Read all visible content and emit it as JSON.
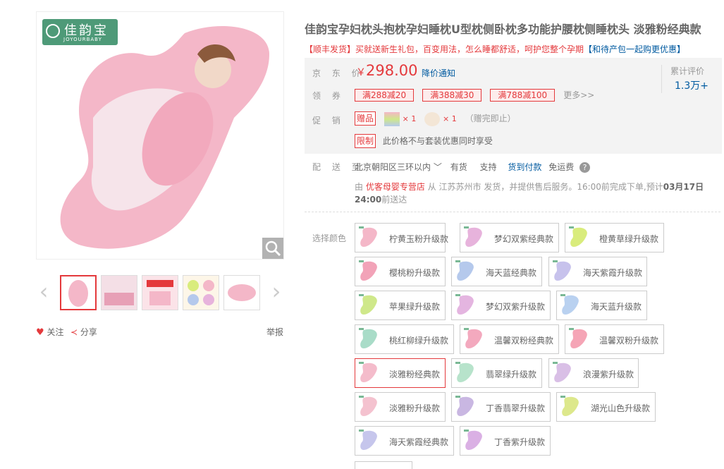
{
  "brand": {
    "name": "佳韵宝",
    "sub": "JOYOURBABY"
  },
  "product": {
    "title": "佳韵宝孕妇枕头抱枕孕妇睡枕U型枕侧卧枕多功能护腰枕侧睡枕头 淡雅粉经典款",
    "promo_text": "【顺丰发货】买就送新生礼包，百变用法，怎么睡都舒适，呵护您整个孕期",
    "promo_link": "【和待产包一起购更优惠】"
  },
  "price": {
    "label": "京 东 价",
    "symbol": "￥",
    "value": "298.00",
    "notify": "降价通知"
  },
  "review": {
    "label": "累计评价",
    "count": "1.3万+"
  },
  "coupons": {
    "label": "领 券",
    "items": [
      "满288减20",
      "满388减30",
      "满788减100"
    ],
    "more": "更多>>"
  },
  "promotion": {
    "label": "促 销",
    "gift_tag": "赠品",
    "gift_qty1": "× 1",
    "gift_qty2": "× 1",
    "gift_note": "（赠完即止）",
    "limit_tag": "限制",
    "limit_text": "此价格不与套装优惠同时享受"
  },
  "delivery": {
    "label": "配 送 至",
    "address": "北京朝阳区三环以内",
    "stock": "有货",
    "support": "支持",
    "cod": "货到付款",
    "free": "免运费",
    "by": "由",
    "store": "优客母婴专营店",
    "from": "从 江苏苏州市 发货，并提供售后服务。16:00前完成下单,预计",
    "date": "03月17日 24:00",
    "arrive": "前送达"
  },
  "actions": {
    "follow": "关注",
    "share": "分享",
    "report": "举报"
  },
  "colors": {
    "label": "选择颜色",
    "options": [
      {
        "name": "柠黄玉粉升级款",
        "tint": "#f4b7c8"
      },
      {
        "name": "梦幻双紫经典款",
        "tint": "#e7b3dc"
      },
      {
        "name": "橙黄草绿升级款",
        "tint": "#d9ec7c"
      },
      {
        "name": "樱桃粉升级款",
        "tint": "#f2a3b8"
      },
      {
        "name": "海天蓝经典款",
        "tint": "#b5c9ec"
      },
      {
        "name": "海天紫霞升级款",
        "tint": "#c7c2ec"
      },
      {
        "name": "苹果绿升级款",
        "tint": "#cfe88a"
      },
      {
        "name": "梦幻双紫升级款",
        "tint": "#e4b5e0"
      },
      {
        "name": "海天蓝升级款",
        "tint": "#b9d1f0"
      },
      {
        "name": "桃红柳绿升级款",
        "tint": "#a9dcc8"
      },
      {
        "name": "温馨双粉经典款",
        "tint": "#f3a9be"
      },
      {
        "name": "温馨双粉升级款",
        "tint": "#f5a5b6"
      },
      {
        "name": "淡雅粉经典款",
        "tint": "#f4bccb"
      },
      {
        "name": "翡翠绿升级款",
        "tint": "#b7e3cb"
      },
      {
        "name": "浪漫紫升级款",
        "tint": "#d9bfe6"
      },
      {
        "name": "淡雅粉升级款",
        "tint": "#f4c2cf"
      },
      {
        "name": "丁香翡翠升级款",
        "tint": "#c9b7e2"
      },
      {
        "name": "湖光山色升级款",
        "tint": "#dde88c"
      },
      {
        "name": "海天紫霞经典款",
        "tint": "#c6c6ec"
      },
      {
        "name": "丁香紫升级款",
        "tint": "#dab0e4"
      }
    ]
  },
  "accent": "#e4393c"
}
